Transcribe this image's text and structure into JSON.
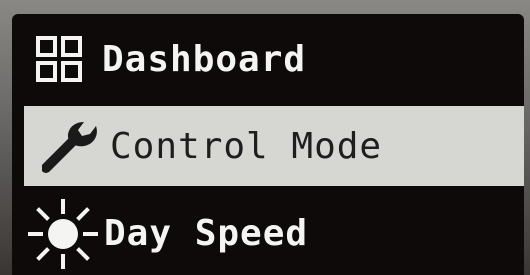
{
  "menu": {
    "items": [
      {
        "label": "Dashboard",
        "icon": "grid-icon",
        "selected": false
      },
      {
        "label": "Control Mode",
        "icon": "wrench-icon",
        "selected": true
      },
      {
        "label": "Day Speed",
        "icon": "sun-icon",
        "selected": false
      }
    ]
  },
  "colors": {
    "screen_bg": "#0d0a09",
    "text": "#f4f4f2",
    "selected_bg": "#d6d6d3",
    "selected_text": "#1e1e1e"
  }
}
